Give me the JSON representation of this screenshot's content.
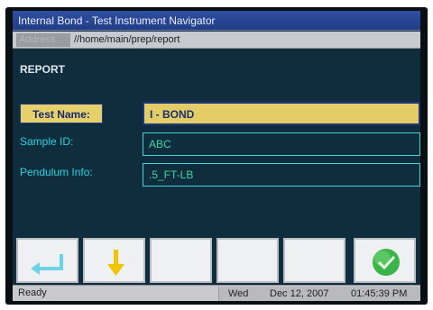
{
  "window": {
    "title": "Internal Bond - Test Instrument Navigator"
  },
  "address_bar": {
    "label": "Address",
    "path": "//home/main/prep/report"
  },
  "page": {
    "section_title": "REPORT",
    "fields": {
      "test_name": {
        "label": "Test Name:",
        "value": "I - BOND"
      },
      "sample_id": {
        "label": "Sample ID:",
        "value": "ABC"
      },
      "pendulum_info": {
        "label": "Pendulum Info:",
        "value": ".5_FT-LB"
      }
    }
  },
  "toolbar": {
    "buttons": [
      {
        "icon": "enter-icon",
        "color": "#6fd3e8"
      },
      {
        "icon": "down-arrow-icon",
        "color": "#f0c400"
      },
      {
        "icon": "none"
      },
      {
        "icon": "none"
      },
      {
        "icon": "none"
      },
      {
        "icon": "check-icon",
        "color": "#3ab54a"
      }
    ]
  },
  "status_bar": {
    "status": "Ready",
    "day": "Wed",
    "date": "Dec 12, 2007",
    "time": "01:45:39 PM"
  },
  "colors": {
    "screen_bg": "#0f2d3c",
    "title_bar": "#2f4fa0",
    "highlight": "#e3cd66",
    "field_text": "#3ad6a9",
    "label_text": "#25d3e0"
  }
}
